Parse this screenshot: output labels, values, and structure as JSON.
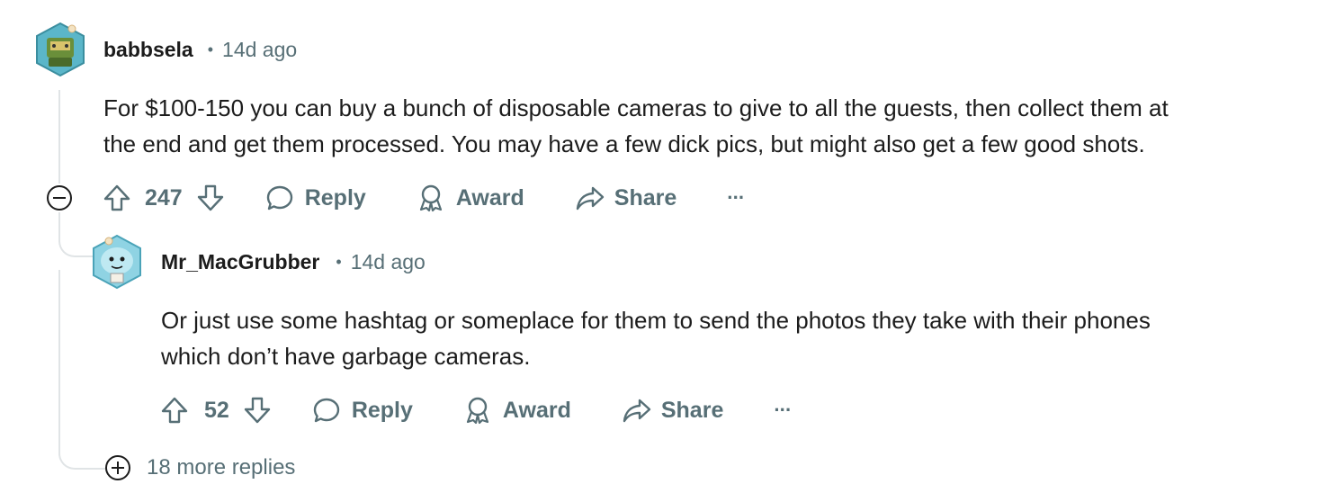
{
  "comments": [
    {
      "author": "babbsela",
      "separator": "•",
      "time": "14d ago",
      "body_line1": "For $100-150 you can buy a bunch of disposable cameras to give to all the guests, then collect them at",
      "body_line2": "the end and get them processed. You may have a few dick pics, but might also get a few good shots.",
      "score": "247",
      "reply_label": "Reply",
      "award_label": "Award",
      "share_label": "Share",
      "more_label": "···"
    },
    {
      "author": "Mr_MacGrubber",
      "separator": "•",
      "time": "14d ago",
      "body_line1": "Or just use some hashtag or someplace for them to send the photos they take with their phones",
      "body_line2": "which don’t have garbage cameras.",
      "score": "52",
      "reply_label": "Reply",
      "award_label": "Award",
      "share_label": "Share",
      "more_label": "···"
    }
  ],
  "more_replies": "18 more replies",
  "colors": {
    "text": "#1c1c1c",
    "meta": "#576f76",
    "thread_line": "#e0e4e6"
  }
}
